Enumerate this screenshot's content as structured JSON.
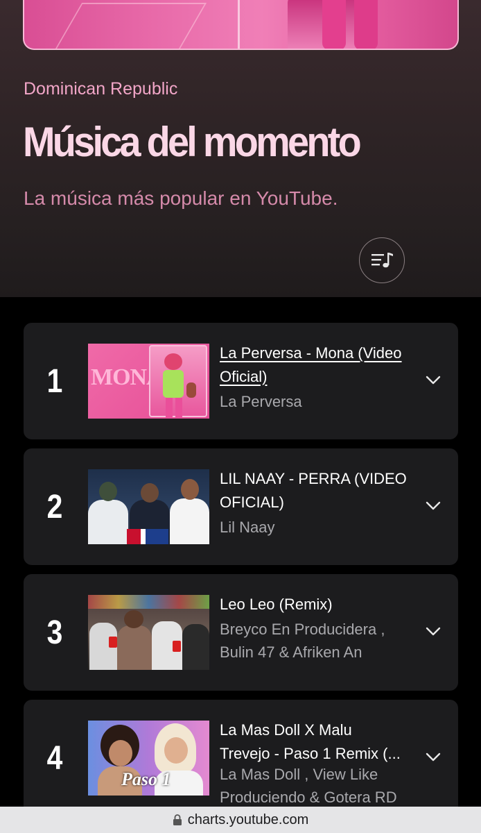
{
  "header": {
    "country": "Dominican Republic",
    "title": "Música del momento",
    "subtitle": "La música más popular en YouTube."
  },
  "icons": {
    "playlist": "playlist-music-icon",
    "expand": "chevron-down-icon",
    "lock": "lock-icon"
  },
  "chart_items": [
    {
      "rank": "1",
      "title_line1": "La Perversa - Mona (Video",
      "title_line2": "Oficial)",
      "artist_line1": "La Perversa",
      "artist_line2": "",
      "thumb_text": "MONA"
    },
    {
      "rank": "2",
      "title_line1": "LIL NAAY - PERRA (VIDEO",
      "title_line2": "OFICIAL)",
      "artist_line1": "Lil Naay",
      "artist_line2": ""
    },
    {
      "rank": "3",
      "title_line1": "Leo Leo (Remix)",
      "title_line2": "",
      "artist_line1": "Breyco En Producidera ,",
      "artist_line2": "Bulin 47 & Afriken An"
    },
    {
      "rank": "4",
      "title_line1": "La Mas Doll X Malu",
      "title_line2": "Trevejo - Paso 1 Remix (...",
      "artist_line1": "La Mas Doll , View Like",
      "artist_line2": "Produciendo & Gotera RD",
      "thumb_text": "Paso 1"
    }
  ],
  "browser": {
    "url": "charts.youtube.com"
  },
  "colors": {
    "accent_pink": "#f2a6c8",
    "title_pink": "#fbd7e6",
    "card_bg": "#1c1c1e"
  }
}
